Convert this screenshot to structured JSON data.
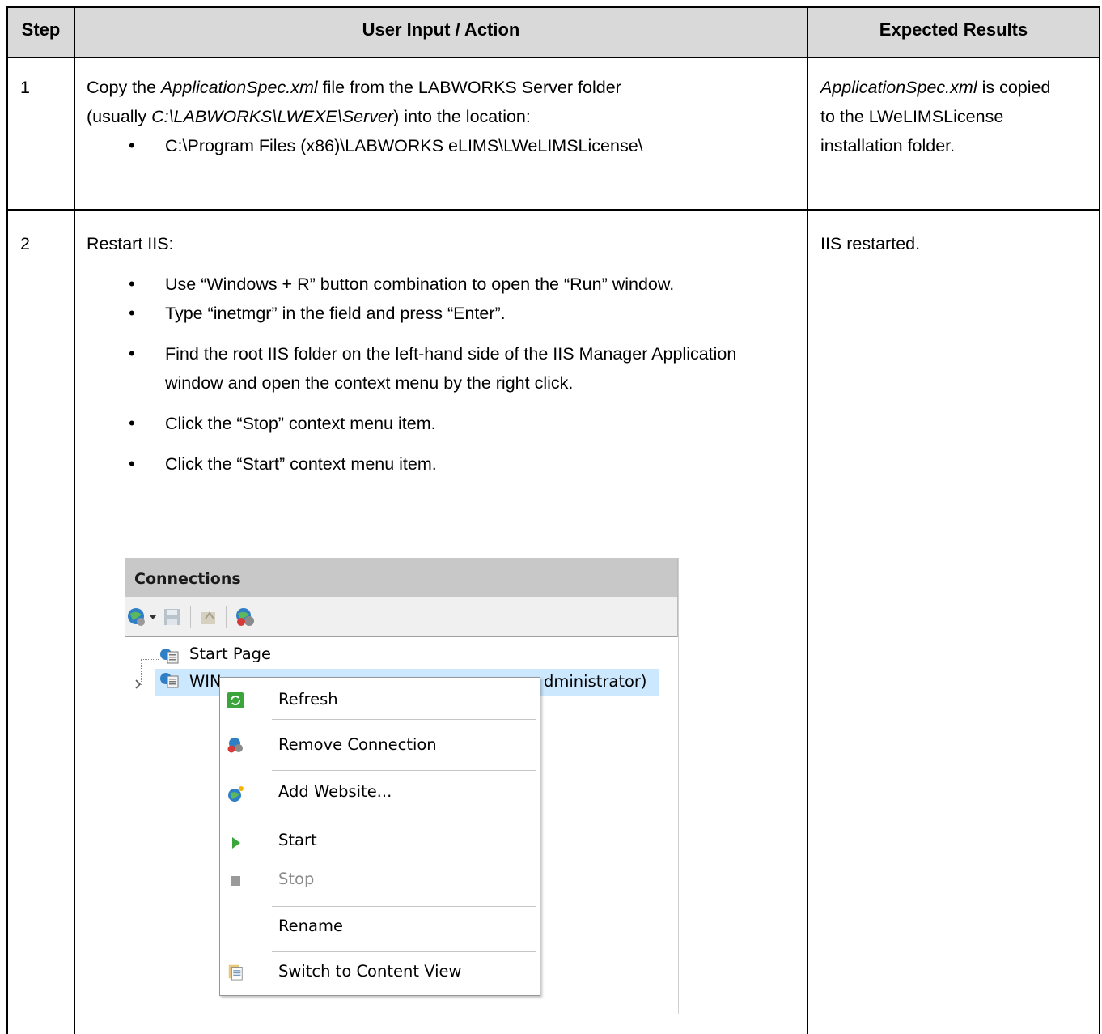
{
  "table": {
    "headers": {
      "step": "Step",
      "action": "User Input / Action",
      "expected": "Expected Results"
    },
    "rows": [
      {
        "step": "1",
        "action": {
          "l1_a": "Copy the ",
          "l1_file": "ApplicationSpec.xml",
          "l1_b": " file from the LABWORKS Server folder",
          "l2_a": "(usually ",
          "l2_path": "C:\\LABWORKS\\LWEXE\\Server",
          "l2_b": ") into the location:",
          "bullet": "C:\\Program Files (x86)\\LABWORKS eLIMS\\LWeLIMSLicense\\"
        },
        "expected": {
          "file": "ApplicationSpec.xml",
          "rest": " is copied to the LWeLIMSLicense installation folder."
        }
      },
      {
        "step": "2",
        "action": {
          "intro": "Restart IIS:",
          "bullets": [
            "Use “Windows + R” button combination to open the “Run” window.",
            "Type “inetmgr” in the field and press “Enter”.",
            "Find the root IIS folder on the left-hand side of the IIS Manager Application window and open the context menu by the right click.",
            "Click the “Stop” context menu item.",
            "Click the “Start” context menu item."
          ]
        },
        "expected": "IIS restarted."
      }
    ]
  },
  "iis": {
    "panel_title": "Connections",
    "tree": {
      "start_page": "Start Page",
      "server_visible_left": "WIN",
      "server_visible_right": "dministrator)"
    },
    "context_menu": {
      "items": [
        {
          "label": "Refresh",
          "icon": "refresh-icon",
          "enabled": true
        },
        {
          "label": "Remove Connection",
          "icon": "remove-connection-icon",
          "enabled": true
        },
        {
          "label": "Add Website...",
          "icon": "add-website-icon",
          "enabled": true
        },
        {
          "label": "Start",
          "icon": "start-play-icon",
          "enabled": true
        },
        {
          "label": "Stop",
          "icon": "stop-square-icon",
          "enabled": false
        },
        {
          "label": "Rename",
          "icon": "",
          "enabled": true
        },
        {
          "label": "Switch to Content View",
          "icon": "content-view-icon",
          "enabled": true
        }
      ]
    },
    "colors": {
      "selection": "#cce8ff",
      "header_bg": "#d9d9d9",
      "start_green": "#3aa53a"
    }
  }
}
